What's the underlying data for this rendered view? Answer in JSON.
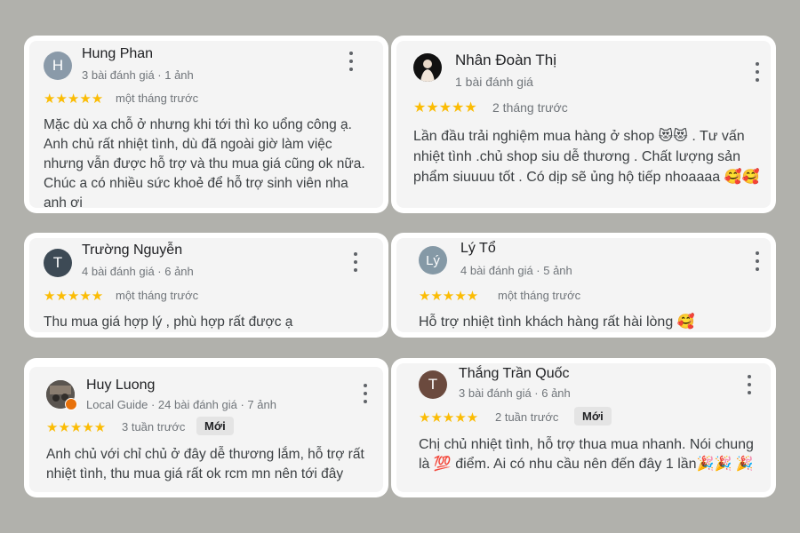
{
  "reviews": [
    {
      "name": "Hung Phan",
      "meta": "3 bài đánh giá · 1 ảnh",
      "avatar_letter": "H",
      "avatar_color": "#8a9aa9",
      "stars": "★★★★★",
      "time": "một tháng trước",
      "text": "Mặc dù xa chỗ ở nhưng khi tới thì ko uổng công ạ. Anh chủ rất nhiệt tình, dù đã ngoài giờ làm việc nhưng vẫn được hỗ trợ và thu mua giá cũng ok nữa. Chúc a có nhiều sức khoẻ để hỗ trợ sinh viên nha anh ơi"
    },
    {
      "name": "Nhân Đoàn Thị",
      "meta": "1 bài đánh giá",
      "stars": "★★★★★",
      "time": "2 tháng trước",
      "text": "Lần đầu trải nghiệm mua hàng ở shop 😻😻 . Tư vấn nhiệt tình .chủ shop siu dễ thương . Chất lượng sản phẩm siuuuu tốt . Có dịp sẽ ủng hộ tiếp nhoaaaa 🥰🥰"
    },
    {
      "name": "Trường Nguyễn",
      "meta": "4 bài đánh giá · 6 ảnh",
      "avatar_letter": "T",
      "avatar_color": "#3d4a55",
      "stars": "★★★★★",
      "time": "một tháng trước",
      "text": "Thu mua giá hợp lý , phù hợp rất được ạ"
    },
    {
      "name": "Lý Tổ",
      "meta": "4 bài đánh giá · 5 ảnh",
      "avatar_letter": "Lý",
      "avatar_color": "#8599a6",
      "stars": "★★★★★",
      "time": "một tháng trước",
      "text": "Hỗ trợ nhiệt tình khách hàng rất hài lòng 🥰"
    },
    {
      "name": "Huy Luong",
      "meta": "Local Guide · 24 bài đánh giá · 7 ảnh",
      "stars": "★★★★★",
      "time": "3 tuần trước",
      "badge": "Mới",
      "text": "Anh chủ với chỉ chủ ở đây dễ thương lắm, hỗ trợ rất nhiệt tình, thu mua giá rất ok rcm mn nên tới đây"
    },
    {
      "name": "Thắng Trần Quốc",
      "meta": "3 bài đánh giá · 6 ảnh",
      "avatar_letter": "T",
      "avatar_color": "#6b4a3e",
      "stars": "★★★★★",
      "time": "2 tuần trước",
      "badge": "Mới",
      "text": "Chị chủ nhiệt tình, hỗ trợ thua mua nhanh. Nói chung là 💯 điểm. Ai có nhu cầu nên đến đây 1 lần🎉🎉 🎉"
    }
  ]
}
